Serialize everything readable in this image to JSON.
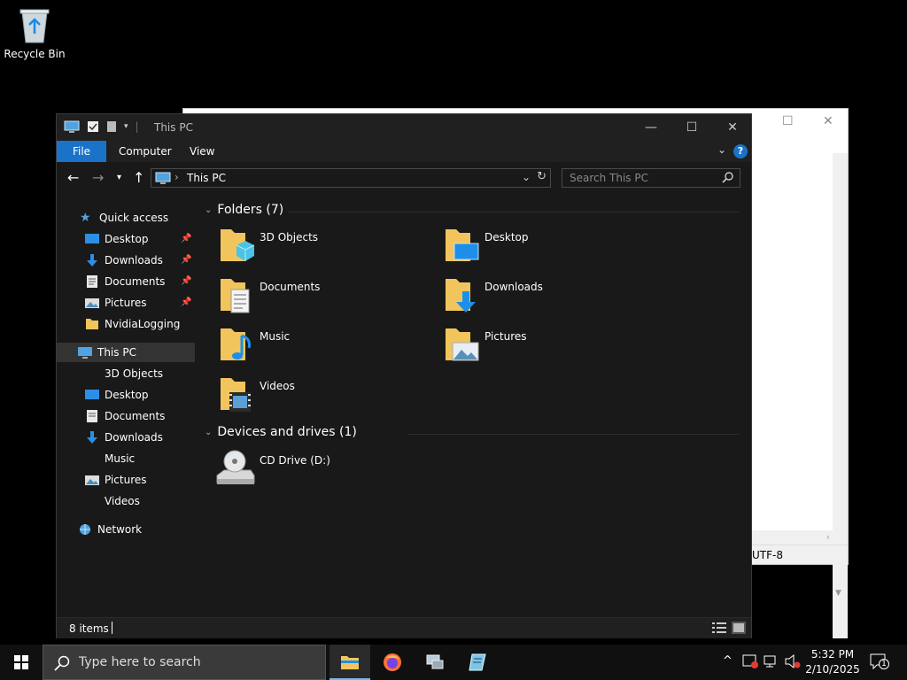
{
  "desktop": {
    "icons": [
      {
        "label": "Recycle Bin",
        "icon": "recycle-bin-icon"
      }
    ]
  },
  "notepad_bg": {
    "encoding": "UTF-8"
  },
  "explorer": {
    "title": "This PC",
    "ribbon_tabs": [
      "File",
      "Computer",
      "View"
    ],
    "help": "?",
    "address": "This PC",
    "search_placeholder": "Search This PC",
    "nav": {
      "quick_access": "Quick access",
      "quick_items": [
        "Desktop",
        "Downloads",
        "Documents",
        "Pictures",
        "NvidiaLogging"
      ],
      "this_pc": "This PC",
      "pc_items": [
        "3D Objects",
        "Desktop",
        "Documents",
        "Downloads",
        "Music",
        "Pictures",
        "Videos"
      ],
      "network": "Network"
    },
    "folders_header": "Folders (7)",
    "folders": [
      "3D Objects",
      "Desktop",
      "Documents",
      "Downloads",
      "Music",
      "Pictures",
      "Videos"
    ],
    "devices_header": "Devices and drives (1)",
    "devices": [
      "CD Drive (D:)"
    ],
    "status": "8 items",
    "accent": "#1a73c8",
    "folder_color": "#f2c55c"
  },
  "taskbar": {
    "search_placeholder": "Type here to search",
    "time": "5:32 PM",
    "date": "2/10/2025",
    "notifications": "1"
  }
}
